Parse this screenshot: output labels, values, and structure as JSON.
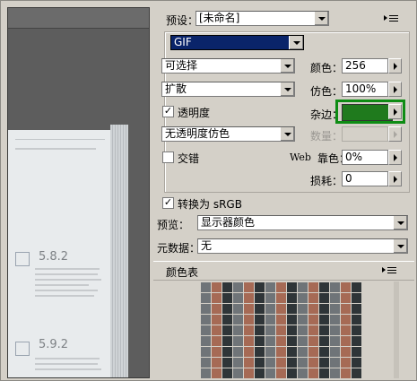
{
  "settings": {
    "preset_label": "预设：",
    "preset_value": "[未命名]",
    "format_value": "GIF",
    "reduction_value": "可选择",
    "dither_algo_value": "扩散",
    "transparency_label": "透明度",
    "transparency_checked": true,
    "trans_dither_value": "无透明度仿色",
    "interlaced_label": "交错",
    "interlaced_checked": false,
    "colors_label": "颜色：",
    "colors_value": "256",
    "dither_label": "仿色：",
    "dither_value": "100%",
    "matte_label": "杂边：",
    "matte_color": "#1f7a1d",
    "amount_label": "数量：",
    "web_snap_label_web": "Web",
    "web_snap_label_cn": "靠色：",
    "web_snap_value": "0%",
    "lossy_label": "损耗：",
    "lossy_value": "0",
    "srgb_label": "转换为 sRGB",
    "srgb_checked": true,
    "preview_label": "预览：",
    "preview_value": "显示器颜色",
    "metadata_label": "元数据：",
    "metadata_value": "无"
  },
  "color_table": {
    "title": "颜色表"
  },
  "preview_doc": {
    "section1": "5.8.2",
    "section2": "5.9.2"
  },
  "icons": {
    "menu": "panel-menu-icon"
  }
}
